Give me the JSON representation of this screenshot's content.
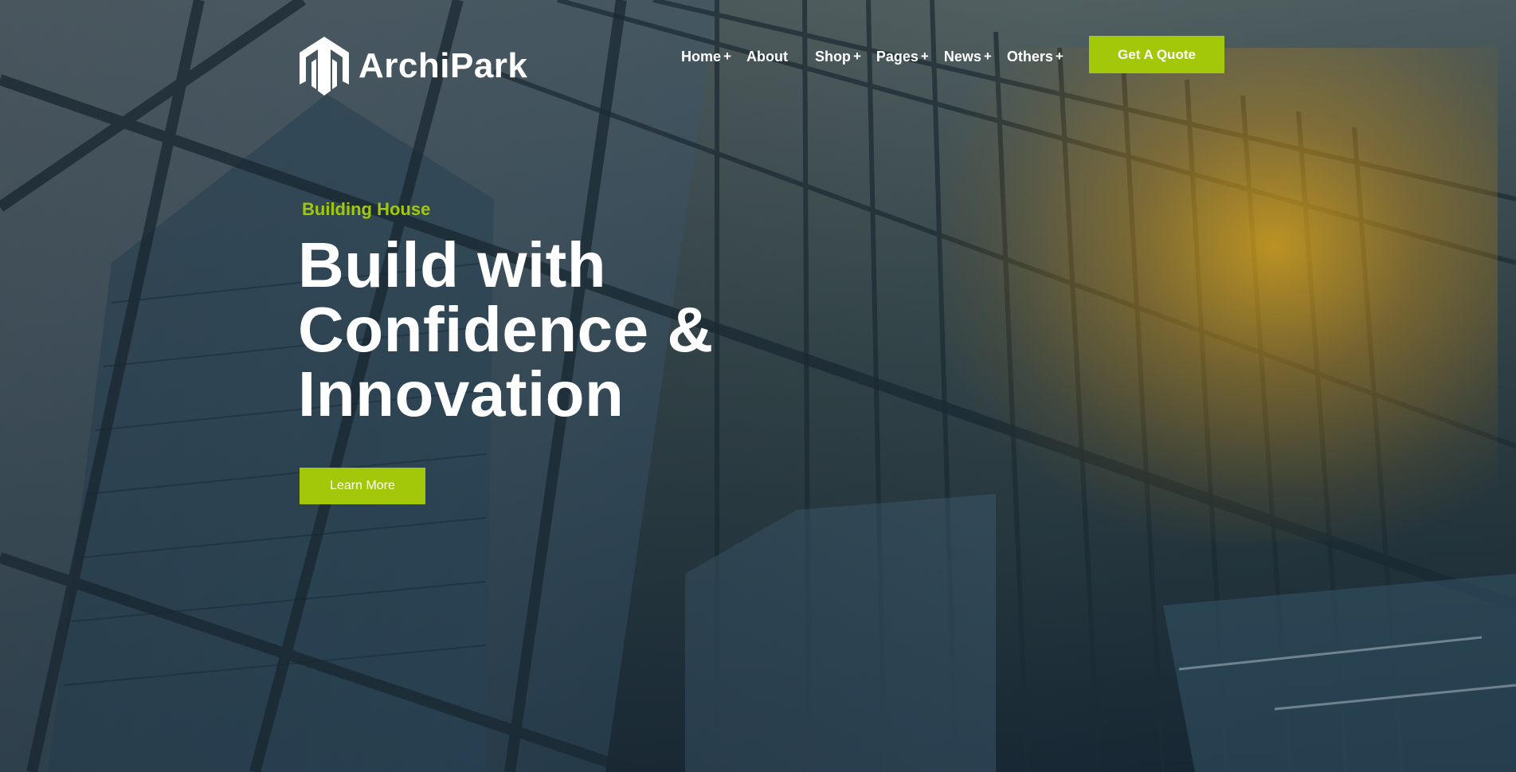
{
  "brand": {
    "name": "ArchiPark",
    "accent_color": "#a3c80a"
  },
  "nav": {
    "items": [
      {
        "label": "Home",
        "has_submenu": true
      },
      {
        "label": "About",
        "has_submenu": false
      },
      {
        "label": "Shop",
        "has_submenu": true
      },
      {
        "label": "Pages",
        "has_submenu": true
      },
      {
        "label": "News",
        "has_submenu": true
      },
      {
        "label": "Others",
        "has_submenu": true
      }
    ],
    "submenu_indicator": "+",
    "cta_label": "Get A Quote"
  },
  "hero": {
    "eyebrow": "Building House",
    "headline_lines": [
      "Build with",
      "Confidence &",
      "Innovation"
    ],
    "button_label": "Learn More"
  }
}
